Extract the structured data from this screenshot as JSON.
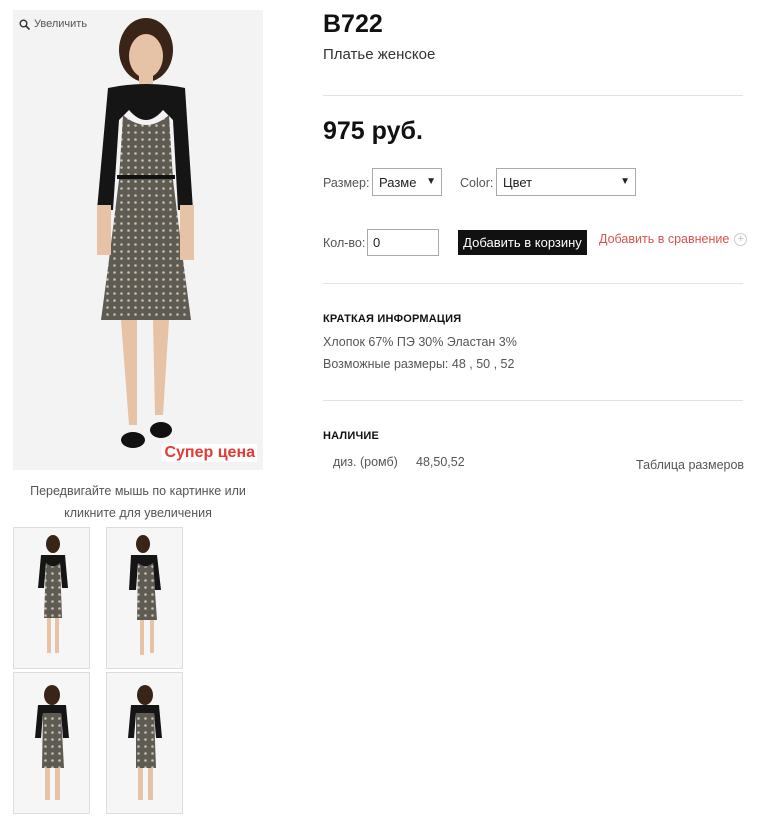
{
  "gallery": {
    "zoom_label": "Увеличить",
    "badge": "Супер цена",
    "hint_line1": "Передвигайте мышь по картинке или",
    "hint_line2": "кликните для увеличения"
  },
  "product": {
    "code": "B722",
    "name": "Платье женское",
    "price": "975 руб."
  },
  "options": {
    "size_label": "Размер:",
    "size_value": "Разме",
    "color_label": "Color:",
    "color_value": "Цвет",
    "qty_label": "Кол-во:",
    "qty_value": "0",
    "cart_button": "Добавить в корзину",
    "compare_link": "Добавить в сравнение"
  },
  "brief": {
    "heading": "КРАТКАЯ ИНФОРМАЦИЯ",
    "composition": "Хлопок 67% ПЭ 30% Эластан 3%",
    "sizes": "Возможные размеры: 48 , 50 , 52"
  },
  "availability": {
    "heading": "НАЛИЧИЕ",
    "variant": "диз. (ромб)",
    "variant_sizes": "48,50,52",
    "size_table_link": "Таблица размеров"
  }
}
